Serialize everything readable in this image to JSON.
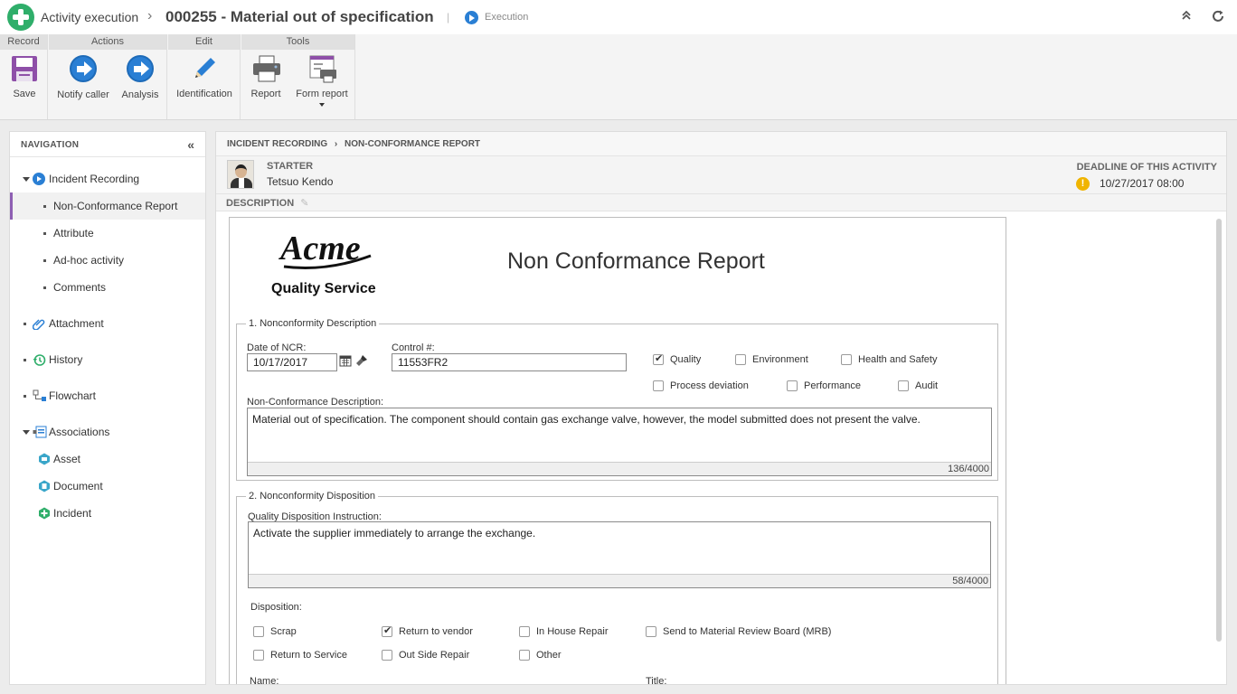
{
  "header": {
    "app_title": "Activity execution",
    "record_title": "000255 - Material out of specification",
    "status": "Execution"
  },
  "ribbon": {
    "groups": [
      "Record",
      "Actions",
      "Edit",
      "Tools"
    ],
    "buttons": {
      "save": "Save",
      "notify_caller": "Notify caller",
      "analysis": "Analysis",
      "identification": "Identification",
      "report": "Report",
      "form_report": "Form report"
    }
  },
  "navigation": {
    "title": "NAVIGATION",
    "items": [
      {
        "label": "Incident Recording",
        "icon": "play-icon"
      },
      {
        "label": "Non-Conformance Report"
      },
      {
        "label": "Attribute"
      },
      {
        "label": "Ad-hoc activity"
      },
      {
        "label": "Comments"
      },
      {
        "label": "Attachment",
        "icon": "paperclip-icon"
      },
      {
        "label": "History",
        "icon": "history-icon"
      },
      {
        "label": "Flowchart",
        "icon": "flowchart-icon"
      },
      {
        "label": "Associations",
        "icon": "associations-icon"
      },
      {
        "label": "Asset",
        "icon": "asset-icon"
      },
      {
        "label": "Document",
        "icon": "document-icon"
      },
      {
        "label": "Incident",
        "icon": "incident-icon"
      }
    ]
  },
  "main": {
    "breadcrumb": [
      "INCIDENT RECORDING",
      "NON-CONFORMANCE REPORT"
    ],
    "starter_label": "STARTER",
    "starter_name": "Tetsuo Kendo",
    "deadline_label": "DEADLINE OF THIS ACTIVITY",
    "deadline_value": "10/27/2017  08:00",
    "description_label": "DESCRIPTION"
  },
  "form": {
    "logo_wordmark": "Acme",
    "logo_subtitle": "Quality Service",
    "title": "Non Conformance Report",
    "section1": {
      "legend": "1. Nonconformity Description",
      "date_label": "Date of NCR:",
      "date_value": "10/17/2017",
      "control_label": "Control #:",
      "control_value": "11553FR2",
      "checkboxes": [
        {
          "label": "Quality",
          "checked": true
        },
        {
          "label": "Environment",
          "checked": false
        },
        {
          "label": "Health and Safety",
          "checked": false
        },
        {
          "label": "Process deviation",
          "checked": false
        },
        {
          "label": "Performance",
          "checked": false
        },
        {
          "label": "Audit",
          "checked": false
        }
      ],
      "desc_label": "Non-Conformance Description:",
      "desc_value": "Material out of specification. The component should contain gas exchange valve, however, the model submitted does not present the valve.",
      "desc_counter": "136/4000"
    },
    "section2": {
      "legend": "2. Nonconformity Disposition",
      "instr_label": "Quality Disposition Instruction:",
      "instr_value": "Activate the supplier immediately to arrange the exchange.",
      "instr_counter": "58/4000",
      "disposition_label": "Disposition:",
      "checkboxes": [
        {
          "label": "Scrap",
          "checked": false
        },
        {
          "label": "Return to vendor",
          "checked": true
        },
        {
          "label": "In House Repair",
          "checked": false
        },
        {
          "label": "Send to Material Review Board (MRB)",
          "checked": false
        },
        {
          "label": "Return to Service",
          "checked": false
        },
        {
          "label": "Out Side Repair",
          "checked": false
        },
        {
          "label": "Other",
          "checked": false
        }
      ],
      "name_label": "Name:",
      "title_label": "Title:"
    }
  },
  "colors": {
    "accent": "#2a7fd4",
    "selected_marker": "#8e5fb3",
    "logo_green": "#2fae6a",
    "warning": "#f0b400"
  }
}
